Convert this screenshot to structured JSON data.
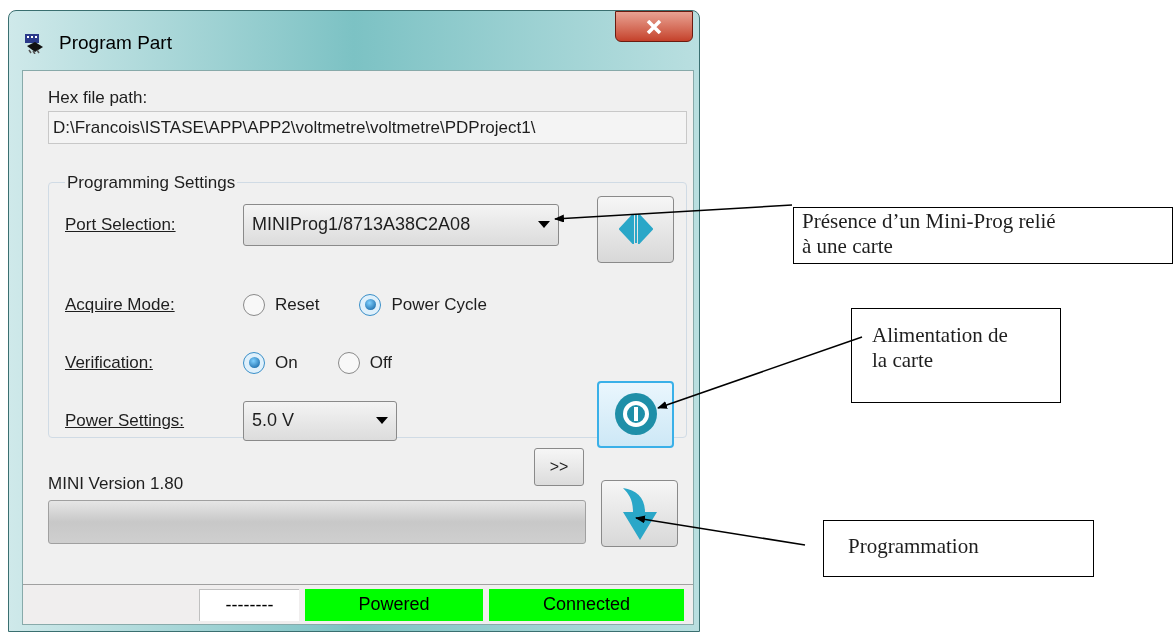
{
  "window": {
    "title": "Program Part"
  },
  "hex_file": {
    "label": "Hex file path:",
    "value": "D:\\Francois\\ISTASE\\APP\\APP2\\voltmetre\\voltmetre\\PDProject1\\"
  },
  "programming_settings": {
    "title": "Programming Settings",
    "port": {
      "label": "Port Selection:",
      "value": "MINIProg1/8713A38C2A08"
    },
    "acquire_mode": {
      "label": "Acquire Mode:",
      "options": [
        {
          "label": "Reset",
          "selected": false
        },
        {
          "label": "Power Cycle",
          "selected": true
        }
      ]
    },
    "verification": {
      "label": "Verification:",
      "options": [
        {
          "label": "On",
          "selected": true
        },
        {
          "label": "Off",
          "selected": false
        }
      ]
    },
    "power": {
      "label": "Power Settings:",
      "value": "5.0 V"
    }
  },
  "version": {
    "label": "MINI Version 1.80",
    "expand_button": ">>"
  },
  "status_bar": [
    {
      "text": "--------",
      "color": "#ffffff"
    },
    {
      "text": "Powered",
      "color": "#00ff00"
    },
    {
      "text": "Connected",
      "color": "#00ff00"
    }
  ],
  "annotations": [
    {
      "text": "Présence d’un Mini-Prog relié à une carte"
    },
    {
      "text": "Alimentation de la carte"
    },
    {
      "text": "Programmation"
    }
  ]
}
